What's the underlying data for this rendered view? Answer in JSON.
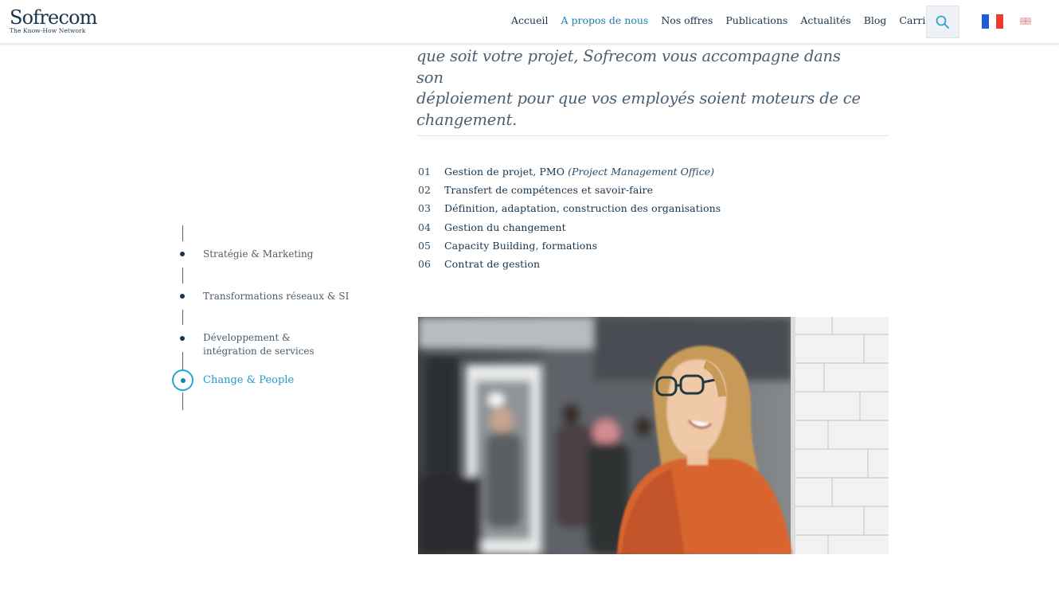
{
  "header": {
    "logo": {
      "name": "Sofrecom",
      "tagline": "The Know-How Network"
    },
    "nav": [
      {
        "label": "Accueil",
        "active": false
      },
      {
        "label": "A propos de nous",
        "active": true
      },
      {
        "label": "Nos offres",
        "active": false
      },
      {
        "label": "Publications",
        "active": false
      },
      {
        "label": "Actualités",
        "active": false
      },
      {
        "label": "Blog",
        "active": false
      },
      {
        "label": "Carrières",
        "active": false
      }
    ],
    "search_icon": "search-icon",
    "languages": [
      "flag-fr",
      "flag-en"
    ]
  },
  "intro": {
    "quote_line1": "que soit votre projet, Sofrecom vous accompagne dans son",
    "quote_line2": "déploiement pour que vos employés soient moteurs de ce",
    "quote_line3": "changement."
  },
  "services": [
    {
      "num": "01",
      "title": "Gestion de projet, PMO",
      "note": "(Project Management Office)"
    },
    {
      "num": "02",
      "title": "Transfert de compétences et savoir-faire",
      "note": ""
    },
    {
      "num": "03",
      "title": "Définition, adaptation, construction des organisations",
      "note": ""
    },
    {
      "num": "04",
      "title": "Gestion du changement",
      "note": ""
    },
    {
      "num": "05",
      "title": "Capacity Building, formations",
      "note": ""
    },
    {
      "num": "06",
      "title": "Contrat de gestion",
      "note": ""
    }
  ],
  "side_nav": [
    {
      "line1": "Stratégie & Marketing",
      "line2": "",
      "active": false
    },
    {
      "line1": "Transformations réseaux & SI",
      "line2": "",
      "active": false
    },
    {
      "line1": "Développement &",
      "line2": "intégration de services",
      "active": false
    },
    {
      "line1": "Change & People",
      "line2": "",
      "active": true
    }
  ],
  "colors": {
    "navy": "#16324a",
    "accent": "#1f7fab",
    "active_ring": "#23a6d4"
  }
}
